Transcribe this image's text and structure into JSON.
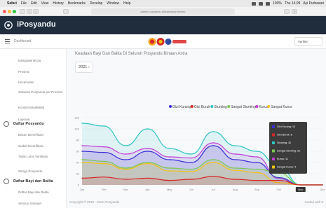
{
  "menubar": {
    "app": "Safari",
    "items": [
      "File",
      "Edit",
      "View",
      "History",
      "Bookmarks",
      "Develop",
      "Window",
      "Help"
    ],
    "battery": "100%",
    "clock": "Thu 14.09",
    "user": "Ayi Purbasari"
  },
  "browser": {
    "url": "admin.posyandu.id/dashboard/index"
  },
  "app": {
    "brand": "iPosyandu",
    "breadcrumb": "Dashboard",
    "user_menu": "Verifier"
  },
  "sidebar": {
    "top_items": [
      "Kabupaten/Kota",
      "Provinsi",
      "Kecamatan",
      "Sebaran Posyandu per Provinsi",
      "Kondisi Bayi/Balita",
      "Laporan"
    ],
    "group1": {
      "label": "Daftar Posyandu"
    },
    "group1_items": [
      "Belum Diverifikasi",
      "Sudah Diverifikasi",
      "Tidak Lolos Verifikasi",
      "Warga Posyandu"
    ],
    "group2": {
      "label": "Daftar Bayi dan Balita"
    },
    "group2_items": [
      "Daftar Bayi dan Balita",
      "Sensus Sampah"
    ]
  },
  "main": {
    "title": "Keadaan Bayi Dan Balita Di Seluruh Posyandu Binaan Astra",
    "year": "2021"
  },
  "footer": {
    "left": "Copyright © 2020 - 2021 iPosyandu",
    "right": "Coded with ♥"
  },
  "colors": {
    "header_bg": "#1f2d3d",
    "gizi_kurang": "#3b2fd6",
    "gizi_buruk": "#d62828",
    "stunting": "#2ec4c4",
    "sangat_stunting": "#7ac74f",
    "kurus": "#c43bd6",
    "sangat_kurus": "#f4c20d"
  },
  "chart_data": {
    "type": "area",
    "categories": [
      "Jan",
      "Feb",
      "Mar",
      "Apr",
      "May",
      "Jun",
      "Jul",
      "Aug",
      "Sep",
      "Oct",
      "Nov",
      "Dec"
    ],
    "y_ticks": [
      "0",
      "20",
      "40",
      "60",
      "80",
      "100",
      "120"
    ],
    "ylim": [
      0,
      120
    ],
    "legend_position": "top-right",
    "series": [
      {
        "name": "Gizi Kurang",
        "color": "#3b2fd6",
        "values": [
          60,
          58,
          45,
          60,
          45,
          40,
          70,
          45,
          40,
          13,
          0,
          0
        ]
      },
      {
        "name": "Gizi Buruk",
        "color": "#d62828",
        "values": [
          12,
          14,
          10,
          12,
          8,
          10,
          15,
          10,
          8,
          8,
          0,
          0
        ]
      },
      {
        "name": "Stunting",
        "color": "#2ec4c4",
        "values": [
          110,
          105,
          70,
          100,
          65,
          55,
          95,
          70,
          60,
          32,
          0,
          0
        ]
      },
      {
        "name": "Sangat Stunting",
        "color": "#7ac74f",
        "values": [
          45,
          42,
          30,
          40,
          30,
          28,
          45,
          30,
          28,
          22,
          0,
          0
        ]
      },
      {
        "name": "Kurus",
        "color": "#c43bd6",
        "values": [
          70,
          68,
          55,
          65,
          50,
          48,
          75,
          55,
          50,
          11,
          0,
          0
        ]
      },
      {
        "name": "Sangat Kurus",
        "color": "#f4c20d",
        "values": [
          40,
          38,
          28,
          38,
          25,
          24,
          40,
          26,
          22,
          4,
          0,
          0
        ]
      }
    ],
    "tooltip": {
      "category": "Nov",
      "items": [
        {
          "name": "Gizi Kurang",
          "value": "13"
        },
        {
          "name": "Gizi Buruk",
          "value": "8"
        },
        {
          "name": "Stunting",
          "value": "32"
        },
        {
          "name": "Sangat Stunting",
          "value": "22"
        },
        {
          "name": "Kurus",
          "value": "11"
        },
        {
          "name": "Sangat Kurus",
          "value": "4"
        }
      ]
    }
  }
}
